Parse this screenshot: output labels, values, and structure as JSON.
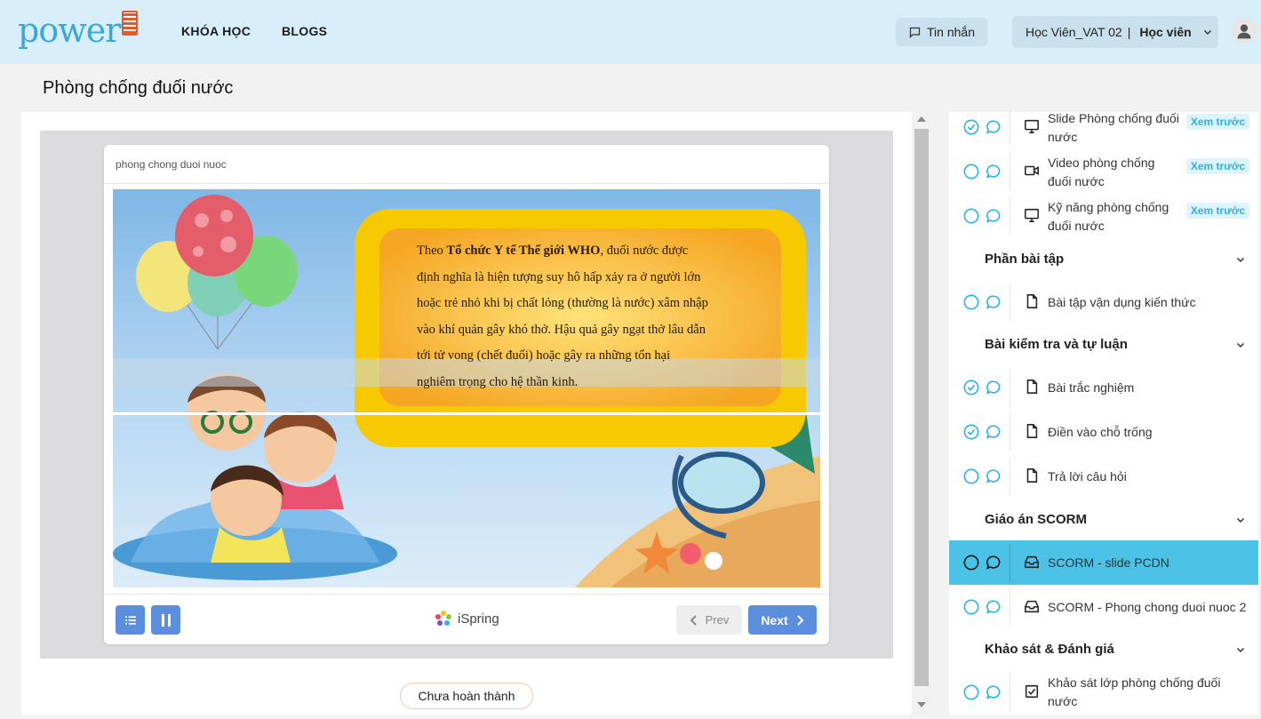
{
  "header": {
    "logo_text": "power",
    "nav": [
      "KHÓA HỌC",
      "BLOGS"
    ],
    "messages_label": "Tin nhắn",
    "user_name": "Học Viên_VAT 02",
    "user_separator": "|",
    "user_role": "Học viên"
  },
  "page": {
    "title": "Phòng chống đuối nước"
  },
  "player": {
    "title": "phong chong duoi nuoc",
    "slide": {
      "text_lines": [
        "Theo",
        "Tổ chức Y tế Thế giới WHO",
        ", đuối nước được",
        "định nghĩa là hiện tượng suy hô hấp xảy ra ở người lớn",
        "hoặc trẻ nhỏ khi bị chất lỏng (thường là nước) xâm nhập",
        "vào khí quản gây khó thở. Hậu quả gây ngạt thở lâu dẫn",
        "tới tử vong (chết đuối) hoặc gây ra những tổn hại",
        "nghiêm trọng cho hệ thần kinh."
      ]
    },
    "brand": "iSpring",
    "prev_label": "Prev",
    "next_label": "Next"
  },
  "status_button": "Chưa hoàn thành",
  "sidebar": {
    "items": [
      {
        "title": "Slide Phòng chống đuối nước",
        "type_icon": "monitor-icon",
        "status": "done",
        "badge": "Xem trước"
      },
      {
        "title": "Video phòng chống đuối nước",
        "type_icon": "video-icon",
        "status": "todo",
        "badge": "Xem trước"
      },
      {
        "title": "Kỹ năng phòng chống đuối nước",
        "type_icon": "monitor-icon",
        "status": "todo",
        "badge": "Xem trước"
      },
      {
        "title": "Bài tập vận dụng kiến thức",
        "type_icon": "document-icon",
        "status": "todo"
      },
      {
        "title": "Bài trắc nghiệm",
        "type_icon": "document-icon",
        "status": "done"
      },
      {
        "title": "Điền vào chỗ trống",
        "type_icon": "document-icon",
        "status": "done"
      },
      {
        "title": "Trả lời câu hỏi",
        "type_icon": "document-icon",
        "status": "todo"
      },
      {
        "title": "SCORM - slide PCDN",
        "type_icon": "inbox-icon",
        "status": "todo",
        "active": true
      },
      {
        "title": "SCORM - Phong chong duoi nuoc 2",
        "type_icon": "inbox-icon",
        "status": "todo"
      },
      {
        "title": "Khảo sát lớp phòng chống đuối nước",
        "type_icon": "checkbox-icon",
        "status": "todo"
      }
    ],
    "sections": [
      "Phần bài tập",
      "Bài kiểm tra và tự luận",
      "Giáo án SCORM",
      "Khảo sát & Đánh giá"
    ]
  },
  "colors": {
    "header_bg": "#d8eefa",
    "accent": "#4cc3e6",
    "player_blue": "#5b8fde",
    "done_check": "#2bb3e0"
  }
}
